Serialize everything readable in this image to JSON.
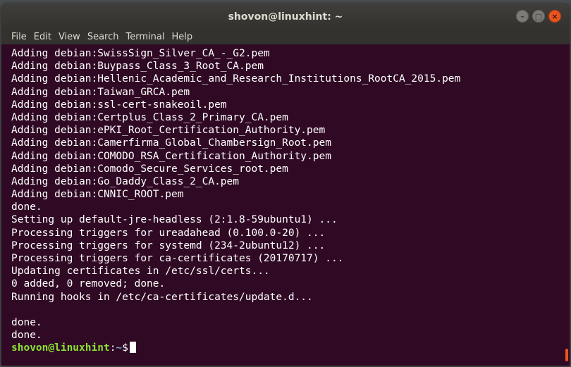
{
  "window": {
    "title": "shovon@linuxhint: ~",
    "buttons": {
      "minimize": "–",
      "maximize": "□",
      "close": "×"
    }
  },
  "menu": [
    "File",
    "Edit",
    "View",
    "Search",
    "Terminal",
    "Help"
  ],
  "terminal": {
    "lines": [
      "Adding debian:SwissSign_Silver_CA_-_G2.pem",
      "Adding debian:Buypass_Class_3_Root_CA.pem",
      "Adding debian:Hellenic_Academic_and_Research_Institutions_RootCA_2015.pem",
      "Adding debian:Taiwan_GRCA.pem",
      "Adding debian:ssl-cert-snakeoil.pem",
      "Adding debian:Certplus_Class_2_Primary_CA.pem",
      "Adding debian:ePKI_Root_Certification_Authority.pem",
      "Adding debian:Camerfirma_Global_Chambersign_Root.pem",
      "Adding debian:COMODO_RSA_Certification_Authority.pem",
      "Adding debian:Comodo_Secure_Services_root.pem",
      "Adding debian:Go_Daddy_Class_2_CA.pem",
      "Adding debian:CNNIC_ROOT.pem",
      "done.",
      "Setting up default-jre-headless (2:1.8-59ubuntu1) ...",
      "Processing triggers for ureadahead (0.100.0-20) ...",
      "Processing triggers for systemd (234-2ubuntu12) ...",
      "Processing triggers for ca-certificates (20170717) ...",
      "Updating certificates in /etc/ssl/certs...",
      "0 added, 0 removed; done.",
      "Running hooks in /etc/ca-certificates/update.d...",
      "",
      "done.",
      "done."
    ],
    "prompt": {
      "user_host": "shovon@linuxhint",
      "separator": ":",
      "path": "~",
      "symbol": "$"
    }
  },
  "colors": {
    "terminal_bg": "#300a24",
    "prompt_user": "#8ae234",
    "prompt_path": "#729fcf",
    "close_button": "#e9541f"
  }
}
